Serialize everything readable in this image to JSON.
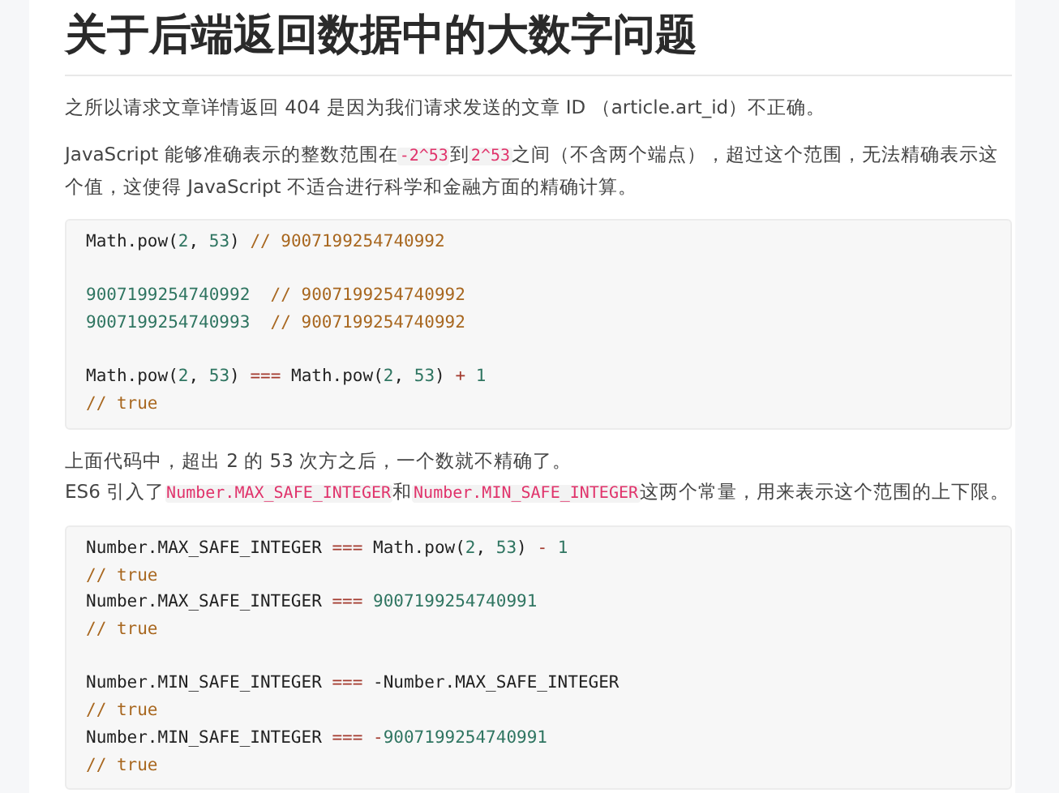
{
  "article": {
    "title": "关于后端返回数据中的大数字问题",
    "blocks": [
      {
        "kind": "paragraph",
        "segments": [
          {
            "kind": "text",
            "text": "之所以请求文章详情返回 404 是因为我们请求发送的文章 ID （article.art_id）不正确。"
          }
        ]
      },
      {
        "kind": "paragraph",
        "segments": [
          {
            "kind": "text",
            "text": "JavaScript 能够准确表示的整数范围在"
          },
          {
            "kind": "code",
            "text": "-2^53"
          },
          {
            "kind": "text",
            "text": "到"
          },
          {
            "kind": "code",
            "text": "2^53"
          },
          {
            "kind": "text",
            "text": "之间（不含两个端点），超过这个范围，无法精确表示这个值，这使得 JavaScript 不适合进行科学和金融方面的精确计算。"
          }
        ]
      },
      {
        "kind": "code",
        "groups": [
          [
            [
              {
                "kind": "plain",
                "text": "Math.pow("
              },
              {
                "kind": "number",
                "text": "2"
              },
              {
                "kind": "plain",
                "text": ", "
              },
              {
                "kind": "number",
                "text": "53"
              },
              {
                "kind": "plain",
                "text": ") "
              },
              {
                "kind": "comment",
                "text": "// 9007199254740992"
              }
            ]
          ],
          [
            [
              {
                "kind": "number",
                "text": "9007199254740992"
              },
              {
                "kind": "comment",
                "text": "  // 9007199254740992"
              }
            ],
            [
              {
                "kind": "number",
                "text": "9007199254740993"
              },
              {
                "kind": "comment",
                "text": "  // 9007199254740992"
              }
            ]
          ],
          [
            [
              {
                "kind": "plain",
                "text": "Math.pow("
              },
              {
                "kind": "number",
                "text": "2"
              },
              {
                "kind": "plain",
                "text": ", "
              },
              {
                "kind": "number",
                "text": "53"
              },
              {
                "kind": "plain",
                "text": ") "
              },
              {
                "kind": "operator",
                "text": "==="
              },
              {
                "kind": "plain",
                "text": " Math.pow("
              },
              {
                "kind": "number",
                "text": "2"
              },
              {
                "kind": "plain",
                "text": ", "
              },
              {
                "kind": "number",
                "text": "53"
              },
              {
                "kind": "plain",
                "text": ") "
              },
              {
                "kind": "operator",
                "text": "+"
              },
              {
                "kind": "number",
                "text": " 1"
              }
            ],
            [
              {
                "kind": "comment",
                "text": "// true"
              }
            ]
          ]
        ]
      },
      {
        "kind": "line",
        "segments": [
          {
            "kind": "text",
            "text": "上面代码中，超出 2 的 53 次方之后，一个数就不精确了。"
          }
        ]
      },
      {
        "kind": "paragraph",
        "segments": [
          {
            "kind": "text",
            "text": "ES6 引入了"
          },
          {
            "kind": "code",
            "text": "Number.MAX_SAFE_INTEGER"
          },
          {
            "kind": "text",
            "text": "和"
          },
          {
            "kind": "code",
            "text": "Number.MIN_SAFE_INTEGER"
          },
          {
            "kind": "text",
            "text": "这两个常量，用来表示这个范围的上下限。"
          }
        ]
      },
      {
        "kind": "code",
        "groups": [
          [
            [
              {
                "kind": "plain",
                "text": "Number.MAX_SAFE_INTEGER "
              },
              {
                "kind": "operator",
                "text": "==="
              },
              {
                "kind": "plain",
                "text": " Math.pow("
              },
              {
                "kind": "number",
                "text": "2"
              },
              {
                "kind": "plain",
                "text": ", "
              },
              {
                "kind": "number",
                "text": "53"
              },
              {
                "kind": "plain",
                "text": ") "
              },
              {
                "kind": "operator",
                "text": "-"
              },
              {
                "kind": "number",
                "text": " 1"
              }
            ],
            [
              {
                "kind": "comment",
                "text": "// true"
              }
            ],
            [
              {
                "kind": "plain",
                "text": "Number.MAX_SAFE_INTEGER "
              },
              {
                "kind": "operator",
                "text": "==="
              },
              {
                "kind": "number",
                "text": " 9007199254740991"
              }
            ],
            [
              {
                "kind": "comment",
                "text": "// true"
              }
            ]
          ],
          [
            [
              {
                "kind": "plain",
                "text": "Number.MIN_SAFE_INTEGER "
              },
              {
                "kind": "operator",
                "text": "==="
              },
              {
                "kind": "plain",
                "text": " -Number.MAX_SAFE_INTEGER"
              }
            ],
            [
              {
                "kind": "comment",
                "text": "// true"
              }
            ],
            [
              {
                "kind": "plain",
                "text": "Number.MIN_SAFE_INTEGER "
              },
              {
                "kind": "operator",
                "text": "==="
              },
              {
                "kind": "operator",
                "text": " -"
              },
              {
                "kind": "number",
                "text": "9007199254740991"
              }
            ],
            [
              {
                "kind": "comment",
                "text": "// true"
              }
            ]
          ]
        ]
      }
    ]
  }
}
